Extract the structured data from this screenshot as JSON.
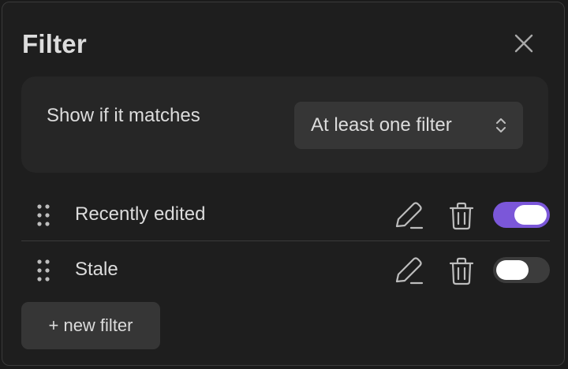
{
  "dialog": {
    "title": "Filter",
    "close_icon": "close-icon"
  },
  "match": {
    "label": "Show if it matches",
    "selected": "At least one filter",
    "chevron_icon": "chevron-updown-icon"
  },
  "filters": [
    {
      "name": "Recently edited",
      "enabled": true
    },
    {
      "name": "Stale",
      "enabled": false
    }
  ],
  "icons": {
    "drag": "drag-handle-icon",
    "edit": "pencil-icon",
    "delete": "trash-icon"
  },
  "colors": {
    "accent": "#7b57d9",
    "background": "#1e1e1e",
    "card": "#262626",
    "control": "#363636"
  },
  "new_filter_label": "+ new filter"
}
